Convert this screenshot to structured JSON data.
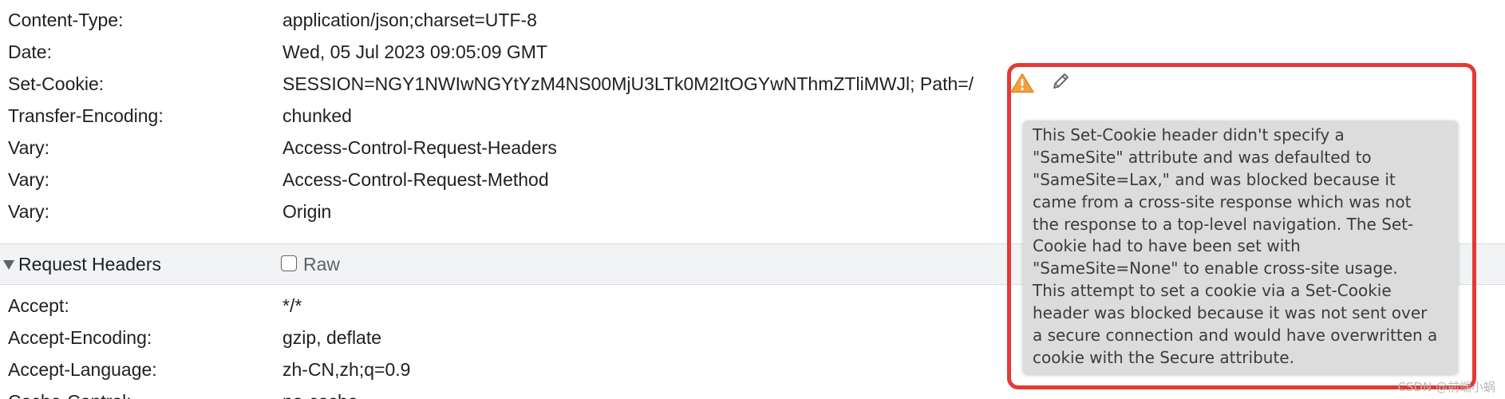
{
  "response_headers": [
    {
      "name": "Content-Type:",
      "value": "application/json;charset=UTF-8"
    },
    {
      "name": "Date:",
      "value": "Wed, 05 Jul 2023 09:05:09 GMT"
    },
    {
      "name": "Set-Cookie:",
      "value": "SESSION=NGY1NWIwNGYtYzM4NS00MjU3LTk0M2ItOGYwNThmZTliMWJl; Path=/"
    },
    {
      "name": "Transfer-Encoding:",
      "value": "chunked"
    },
    {
      "name": "Vary:",
      "value": "Access-Control-Request-Headers"
    },
    {
      "name": "Vary:",
      "value": "Access-Control-Request-Method"
    },
    {
      "name": "Vary:",
      "value": "Origin"
    }
  ],
  "request_section": {
    "title": "Request Headers",
    "raw_label": "Raw",
    "raw_checked": false
  },
  "request_headers": [
    {
      "name": "Accept:",
      "value": "*/*"
    },
    {
      "name": "Accept-Encoding:",
      "value": "gzip, deflate"
    },
    {
      "name": "Accept-Language:",
      "value": "zh-CN,zh;q=0.9"
    },
    {
      "name": "Cache-Control:",
      "value": "no-cache"
    }
  ],
  "icons": {
    "warning": "warning-icon",
    "edit": "pencil-icon"
  },
  "colors": {
    "warning": "#f0a040",
    "highlight_border": "#e53935",
    "tooltip_bg": "#dcdcdc",
    "section_bg": "#f1f3f4"
  },
  "tooltip": {
    "lines": [
      "This Set-Cookie header didn't specify a",
      "\"SameSite\" attribute and was defaulted to",
      "\"SameSite=Lax,\" and was blocked because it",
      "came from a cross-site response which was not",
      "the response to a top-level navigation. The Set-",
      "Cookie had to have been set with",
      "\"SameSite=None\" to enable cross-site usage.",
      "This attempt to set a cookie via a Set-Cookie",
      "header was blocked because it was not sent over",
      "a secure connection and would have overwritten a",
      "cookie with the Secure attribute."
    ]
  },
  "watermark": "CSDN @前端小蜗"
}
